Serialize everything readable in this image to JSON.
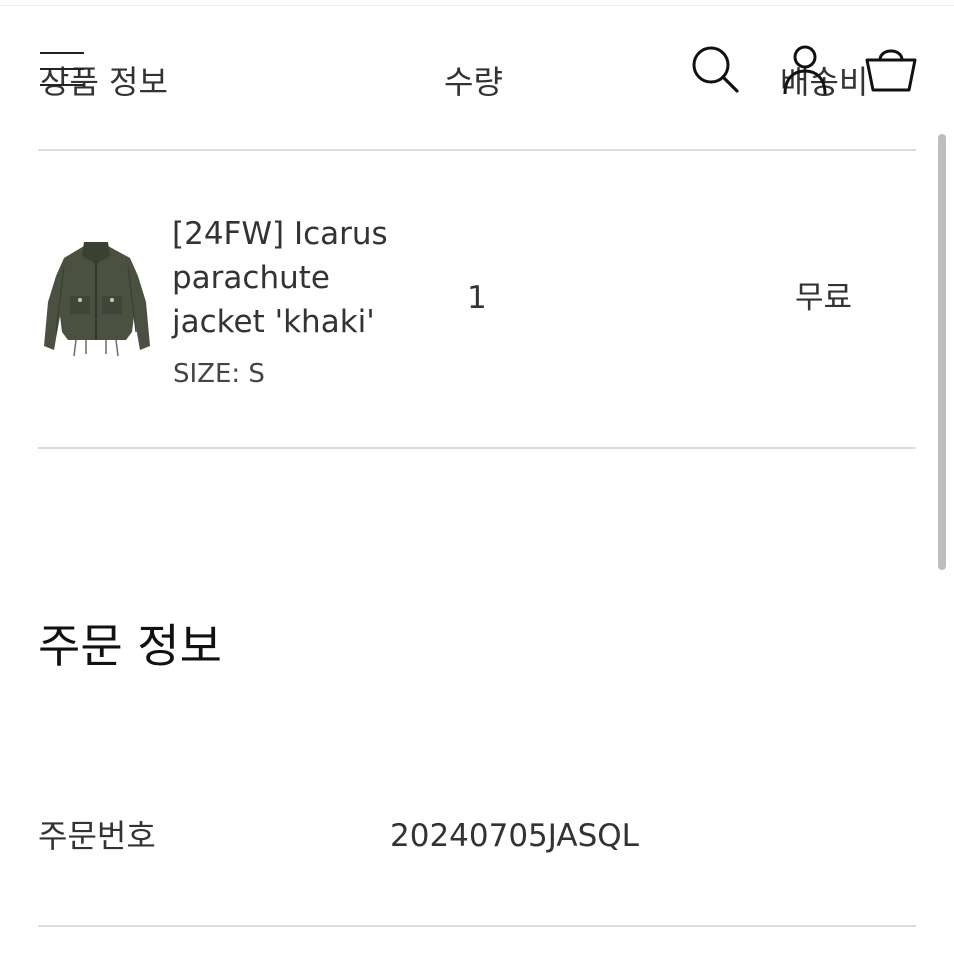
{
  "header": {
    "icons": {
      "menu": "hamburger-icon",
      "search": "search-icon",
      "account": "user-icon",
      "cart": "bag-icon"
    },
    "columns": {
      "product": "상품 정보",
      "quantity": "수량",
      "shipping": "배송비"
    }
  },
  "item": {
    "image": "khaki parachute jacket photo",
    "name": "[24FW] Icarus parachute jacket 'khaki'",
    "size": "SIZE: S",
    "quantity": "1",
    "shipping": "무료"
  },
  "order_info": {
    "title": "주문 정보",
    "order_number_label": "주문번호",
    "order_number": "20240705JASQL"
  },
  "colors": {
    "text": "#333333",
    "divider": "#dcdcdc",
    "jacket": "#4a5140"
  }
}
